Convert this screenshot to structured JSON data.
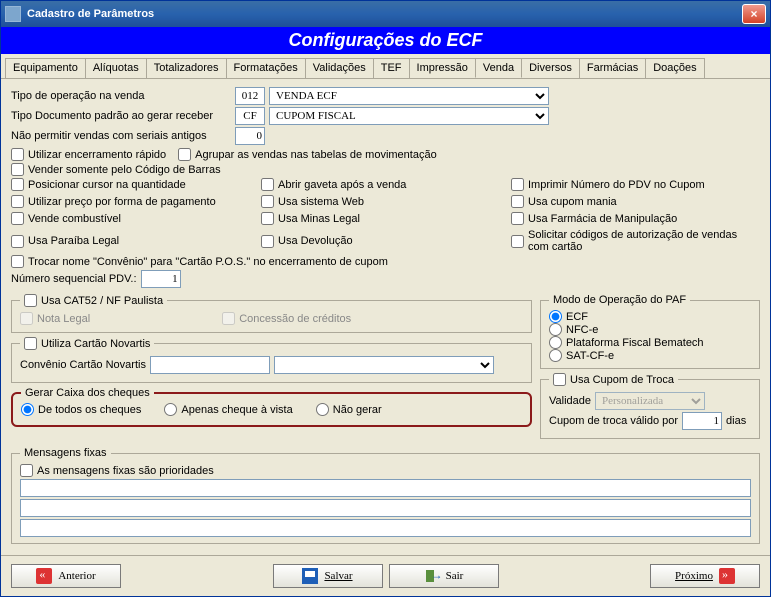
{
  "window": {
    "title": "Cadastro de Parâmetros",
    "banner": "Configurações do ECF"
  },
  "tabs": [
    "Equipamento",
    "Alíquotas",
    "Totalizadores",
    "Formatações",
    "Validações",
    "TEF",
    "Impressão",
    "Venda",
    "Diversos",
    "Farmácias",
    "Doações"
  ],
  "activeTab": "Venda",
  "fields": {
    "tipoOperacaoLabel": "Tipo de operação na venda",
    "tipoOperacaoCode": "012",
    "tipoOperacaoDesc": "VENDA ECF",
    "tipoDocLabel": "Tipo Documento padrão ao gerar receber",
    "tipoDocCode": "CF",
    "tipoDocDesc": "CUPOM FISCAL",
    "naoPermitirLabel": "Não permitir vendas com seriais antigos",
    "naoPermitirVal": "0",
    "numSeqLabel": "Número sequencial PDV.:",
    "numSeqVal": "1"
  },
  "checks": {
    "c1": "Utilizar encerramento rápido",
    "c2": "Agrupar as vendas nas tabelas de movimentação",
    "c3": "Vender somente pelo Código de Barras",
    "c4": "Posicionar cursor na quantidade",
    "c5": "Abrir gaveta após a venda",
    "c6": "Imprimir Número do PDV no Cupom",
    "c7": "Utilizar preço por forma de pagamento",
    "c8": "Usa sistema Web",
    "c9": "Usa cupom mania",
    "c10": "Vende combustível",
    "c11": "Usa Minas Legal",
    "c12": "Usa Farmácia de Manipulação",
    "c13": "Usa Paraíba Legal",
    "c14": "Usa Devolução",
    "c15": "Solicitar códigos de autorização de vendas com cartão",
    "c16": "Trocar nome \"Convênio\" para \"Cartão P.O.S.\" no encerramento de cupom"
  },
  "cat52": {
    "legend": "Usa CAT52 / NF Paulista",
    "notaLegal": "Nota Legal",
    "concessao": "Concessão de créditos"
  },
  "novartis": {
    "legend": "Utiliza Cartão Novartis",
    "label": "Convênio Cartão Novartis"
  },
  "gerarCaixa": {
    "legend": "Gerar Caixa dos cheques",
    "r1": "De todos os cheques",
    "r2": "Apenas cheque à vista",
    "r3": "Não gerar"
  },
  "mensagens": {
    "legend": "Mensagens fixas",
    "chk": "As mensagens fixas são prioridades"
  },
  "modoPAF": {
    "legend": "Modo de Operação do PAF",
    "r1": "ECF",
    "r2": "NFC-e",
    "r3": "Plataforma Fiscal Bematech",
    "r4": "SAT-CF-e"
  },
  "cupomTroca": {
    "legend": "Usa Cupom de Troca",
    "validadeLabel": "Validade",
    "validadeVal": "Personalizada",
    "validoLabel": "Cupom de troca válido por",
    "validoVal": "1",
    "diasLabel": "dias"
  },
  "footer": {
    "anterior": "Anterior",
    "salvar": "Salvar",
    "sair": "Sair",
    "proximo": "Próximo"
  }
}
